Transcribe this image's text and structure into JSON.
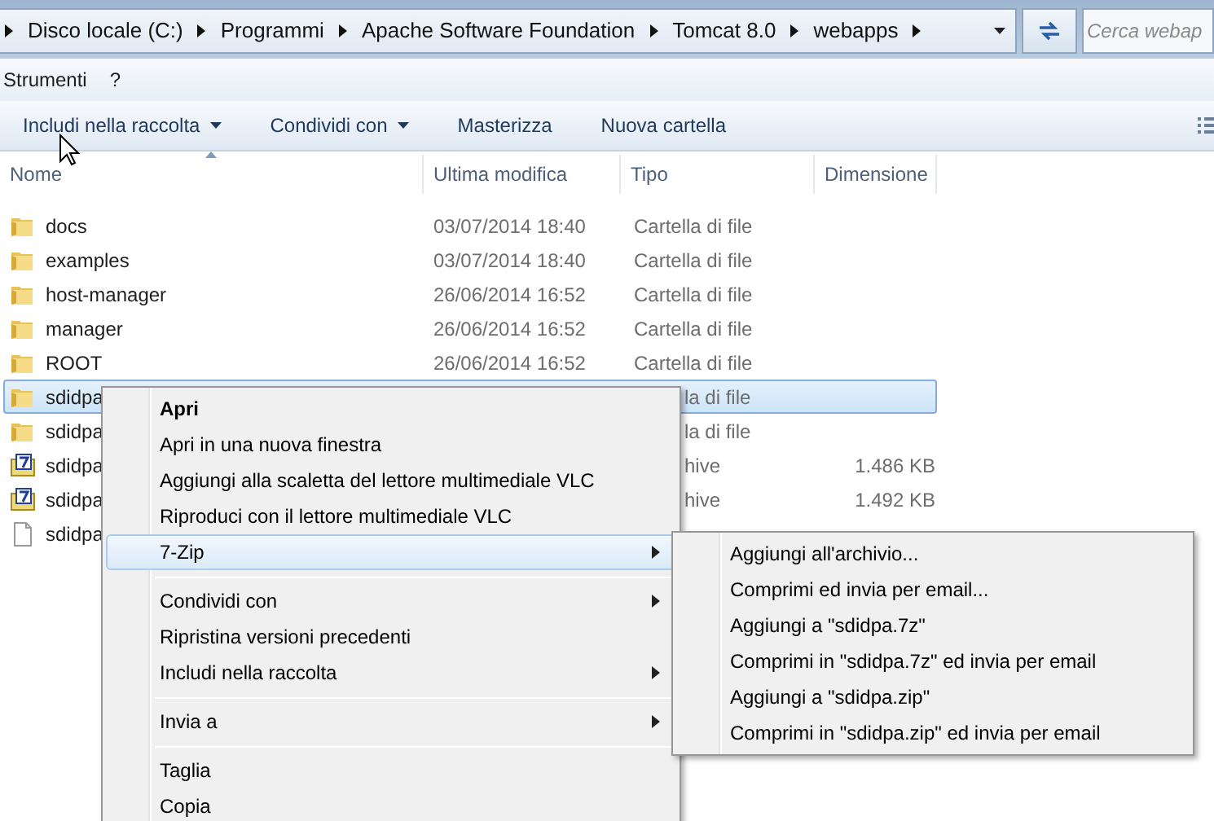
{
  "address_bar": {
    "segments": [
      "Disco locale (C:)",
      "Programmi",
      "Apache Software Foundation",
      "Tomcat 8.0",
      "webapps"
    ]
  },
  "search": {
    "placeholder": "Cerca webap"
  },
  "menu_bar": [
    "Strumenti",
    "?"
  ],
  "toolbar": [
    {
      "label": "Includi nella raccolta",
      "dropdown": true
    },
    {
      "label": "Condividi con",
      "dropdown": true
    },
    {
      "label": "Masterizza",
      "dropdown": false
    },
    {
      "label": "Nuova cartella",
      "dropdown": false
    }
  ],
  "columns": [
    {
      "label": "Nome",
      "sorted": true
    },
    {
      "label": "Ultima modifica",
      "sorted": false
    },
    {
      "label": "Tipo",
      "sorted": false
    },
    {
      "label": "Dimensione",
      "sorted": false
    }
  ],
  "rows": [
    {
      "kind": "folder",
      "name": "docs",
      "modified": "03/07/2014 18:40",
      "type": "Cartella di file",
      "selected": false
    },
    {
      "kind": "folder",
      "name": "examples",
      "modified": "03/07/2014 18:40",
      "type": "Cartella di file",
      "selected": false
    },
    {
      "kind": "folder",
      "name": "host-manager",
      "modified": "26/06/2014 16:52",
      "type": "Cartella di file",
      "selected": false
    },
    {
      "kind": "folder",
      "name": "manager",
      "modified": "26/06/2014 16:52",
      "type": "Cartella di file",
      "selected": false
    },
    {
      "kind": "folder",
      "name": "ROOT",
      "modified": "26/06/2014 16:52",
      "type": "Cartella di file",
      "selected": false
    },
    {
      "kind": "folder",
      "name": "sdidpa",
      "type": "la di file",
      "selected": true
    },
    {
      "kind": "folder",
      "name": "sdidpa",
      "type": "la di file",
      "selected": false
    },
    {
      "kind": "archive",
      "name": "sdidpa",
      "type": "hive",
      "size": "1.486 KB",
      "selected": false
    },
    {
      "kind": "archive",
      "name": "sdidpa",
      "type": "hive",
      "size": "1.492 KB",
      "selected": false
    },
    {
      "kind": "file",
      "name": "sdidpa",
      "selected": false
    }
  ],
  "context_menu": {
    "items": [
      {
        "kind": "item",
        "label": "Apri",
        "bold": true,
        "submenu": false,
        "selected": false
      },
      {
        "kind": "item",
        "label": "Apri in una nuova finestra",
        "bold": false,
        "submenu": false,
        "selected": false
      },
      {
        "kind": "item",
        "label": "Aggiungi alla scaletta del lettore multimediale VLC",
        "bold": false,
        "submenu": false,
        "selected": false
      },
      {
        "kind": "item",
        "label": "Riproduci con il lettore multimediale VLC",
        "bold": false,
        "submenu": false,
        "selected": false
      },
      {
        "kind": "item",
        "label": "7-Zip",
        "bold": false,
        "submenu": true,
        "selected": true
      },
      {
        "kind": "separator"
      },
      {
        "kind": "item",
        "label": "Condividi con",
        "bold": false,
        "submenu": true,
        "selected": false
      },
      {
        "kind": "item",
        "label": "Ripristina versioni precedenti",
        "bold": false,
        "submenu": false,
        "selected": false
      },
      {
        "kind": "item",
        "label": "Includi nella raccolta",
        "bold": false,
        "submenu": true,
        "selected": false
      },
      {
        "kind": "separator"
      },
      {
        "kind": "item",
        "label": "Invia a",
        "bold": false,
        "submenu": true,
        "selected": false
      },
      {
        "kind": "separator"
      },
      {
        "kind": "item",
        "label": "Taglia",
        "bold": false,
        "submenu": false,
        "selected": false
      },
      {
        "kind": "item",
        "label": "Copia",
        "bold": false,
        "submenu": false,
        "selected": false
      }
    ]
  },
  "submenu": {
    "items": [
      "Aggiungi all'archivio...",
      "Comprimi ed invia per email...",
      "Aggiungi a \"sdidpa.7z\"",
      "Comprimi in \"sdidpa.7z\" ed invia per email",
      "Aggiungi a \"sdidpa.zip\"",
      "Comprimi in \"sdidpa.zip\" ed invia per email"
    ]
  }
}
